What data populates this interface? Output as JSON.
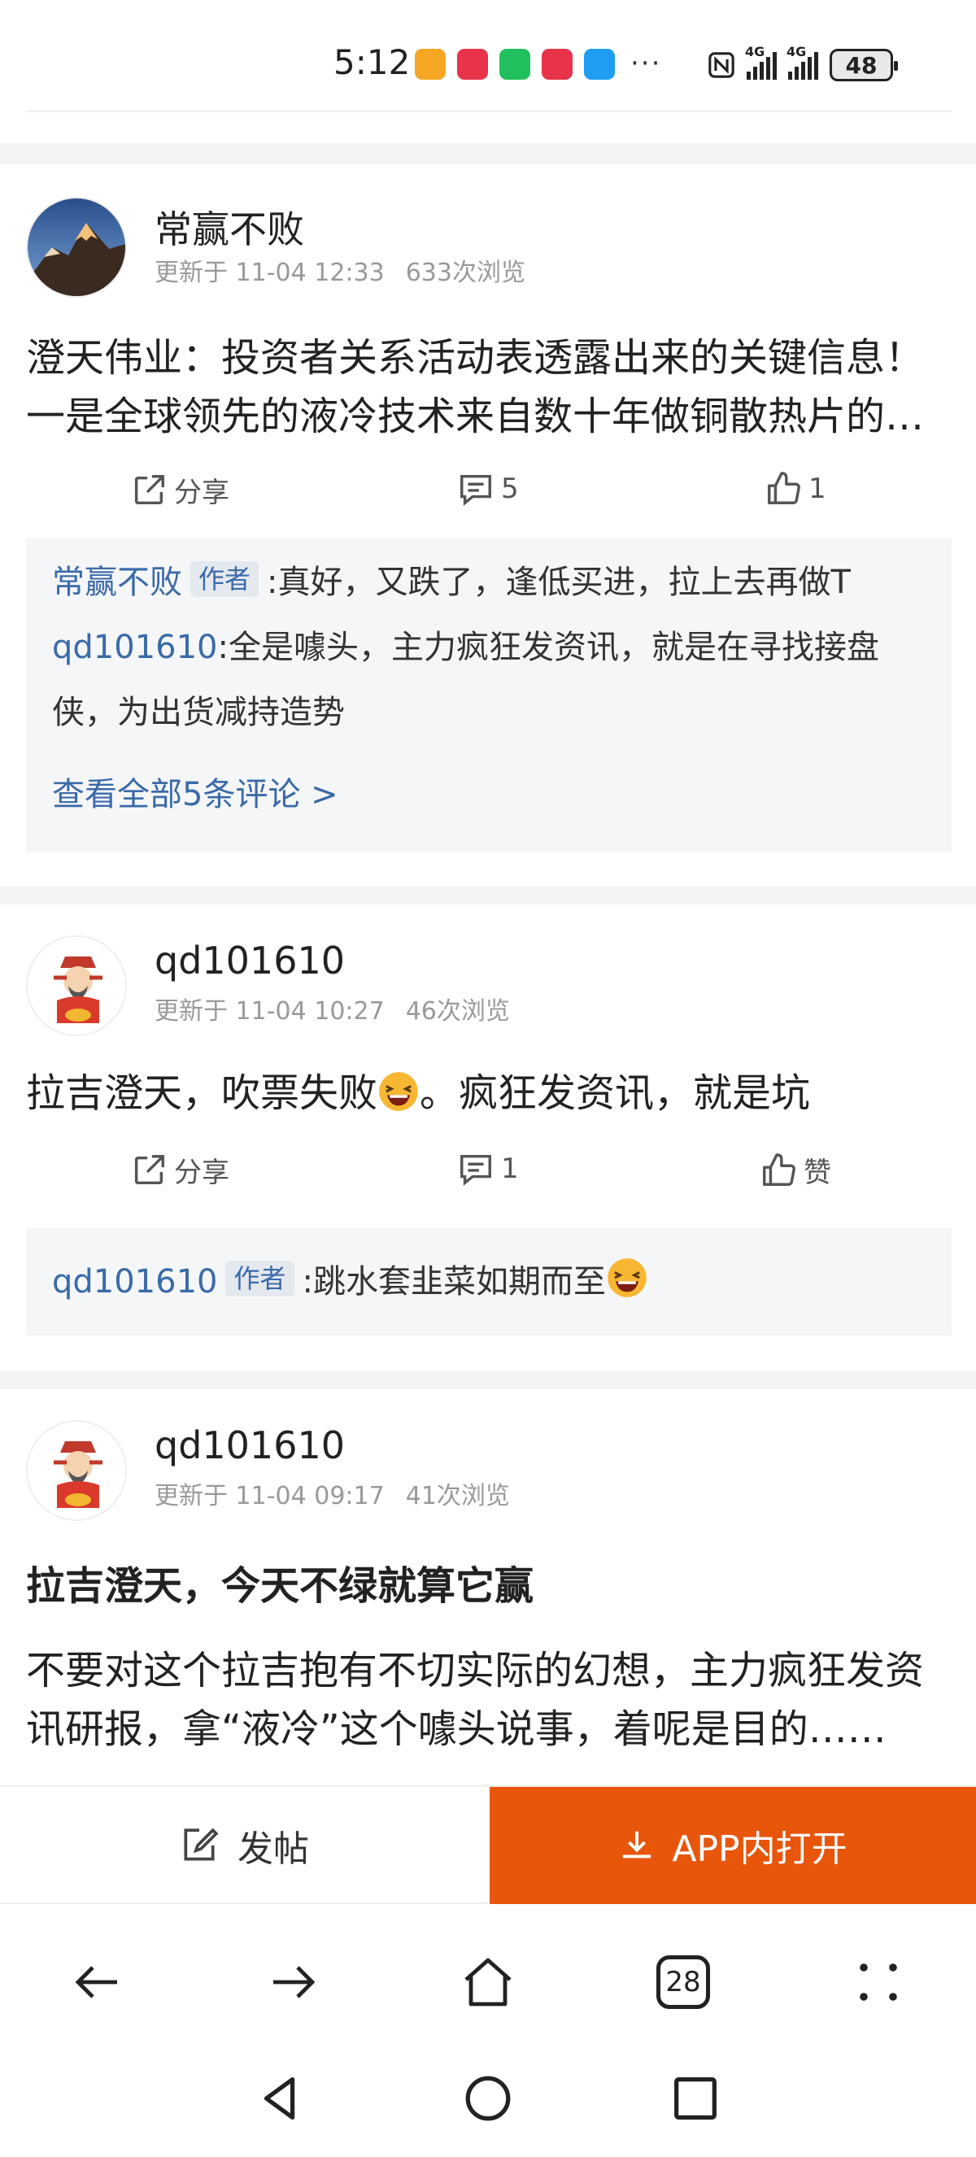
{
  "status_bar": {
    "time": "5:12",
    "dots": "···",
    "battery": "48",
    "signal_1": "4G",
    "signal_2": "4G"
  },
  "posts": [
    {
      "author": "常赢不败",
      "updated": "更新于 11-04 12:33",
      "views": "633次浏览",
      "text": "澄天伟业：投资者关系活动表透露出来的关键信息！ 一是全球领先的液冷技术来自数十年做铜散热片的经验积累，二是……",
      "share_label": "分享",
      "comment_count": "5",
      "like_label": "1",
      "comments": [
        {
          "author": "常赢不败",
          "badge": "作者",
          "text": ":真好，又跌了，逢低买进，拉上去再做T"
        },
        {
          "author": "qd101610",
          "badge": "",
          "text": ":全是噱头，主力疯狂发资讯，就是在寻找接盘侠，为出货减持造势"
        }
      ],
      "view_all": "查看全部5条评论 >"
    },
    {
      "author": "qd101610",
      "updated": "更新于 11-04 10:27",
      "views": "46次浏览",
      "text_before": "拉吉澄天，吹票失败",
      "text_after": "。疯狂发资讯，就是坑",
      "share_label": "分享",
      "comment_count": "1",
      "like_label": "赞",
      "comments": [
        {
          "author": "qd101610",
          "badge": "作者",
          "text": ":跳水套韭菜如期而至"
        }
      ]
    },
    {
      "author": "qd101610",
      "updated": "更新于 11-04 09:17",
      "views": "41次浏览",
      "title": "拉吉澄天，今天不绿就算它赢",
      "text": "不要对这个拉吉抱有不切实际的幻想，主力疯狂发资讯研报，拿“液冷”这个噱头说事，着呢是目的……"
    }
  ],
  "bottom_bar": {
    "post_label": "发帖",
    "open_app_label": "APP内打开"
  },
  "browser_bar": {
    "tab_count": "28"
  },
  "colors": {
    "accent": "#e8560c",
    "link": "#3a6aa8",
    "muted": "#999999",
    "comment_bg": "#f5f6f8"
  }
}
